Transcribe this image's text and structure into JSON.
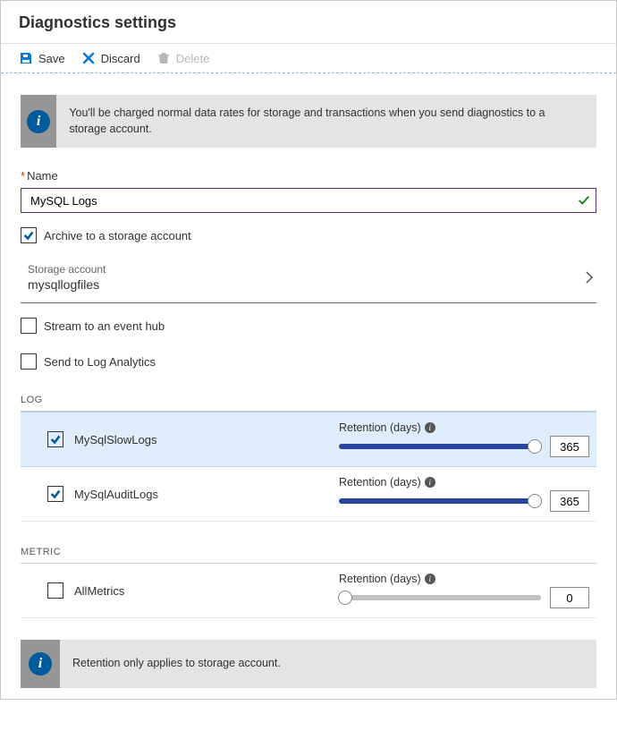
{
  "page": {
    "title": "Diagnostics settings"
  },
  "toolbar": {
    "save_label": "Save",
    "discard_label": "Discard",
    "delete_label": "Delete"
  },
  "info_top": "You'll be charged normal data rates for storage and transactions when you send diagnostics to a storage account.",
  "name": {
    "label": "Name",
    "required": "*",
    "value": "MySQL Logs"
  },
  "options": {
    "archive": {
      "label": "Archive to a storage account",
      "checked": true
    },
    "stream": {
      "label": "Stream to an event hub",
      "checked": false
    },
    "analytics": {
      "label": "Send to Log Analytics",
      "checked": false
    }
  },
  "storage": {
    "label": "Storage account",
    "value": "mysqllogfiles"
  },
  "sections": {
    "log_heading": "LOG",
    "metric_heading": "METRIC",
    "retention_label": "Retention (days)"
  },
  "logs": [
    {
      "name": "MySqlSlowLogs",
      "checked": true,
      "retention": 365,
      "selected": true
    },
    {
      "name": "MySqlAuditLogs",
      "checked": true,
      "retention": 365,
      "selected": false
    }
  ],
  "metrics": [
    {
      "name": "AllMetrics",
      "checked": false,
      "retention": 0
    }
  ],
  "info_bottom": "Retention only applies to storage account."
}
